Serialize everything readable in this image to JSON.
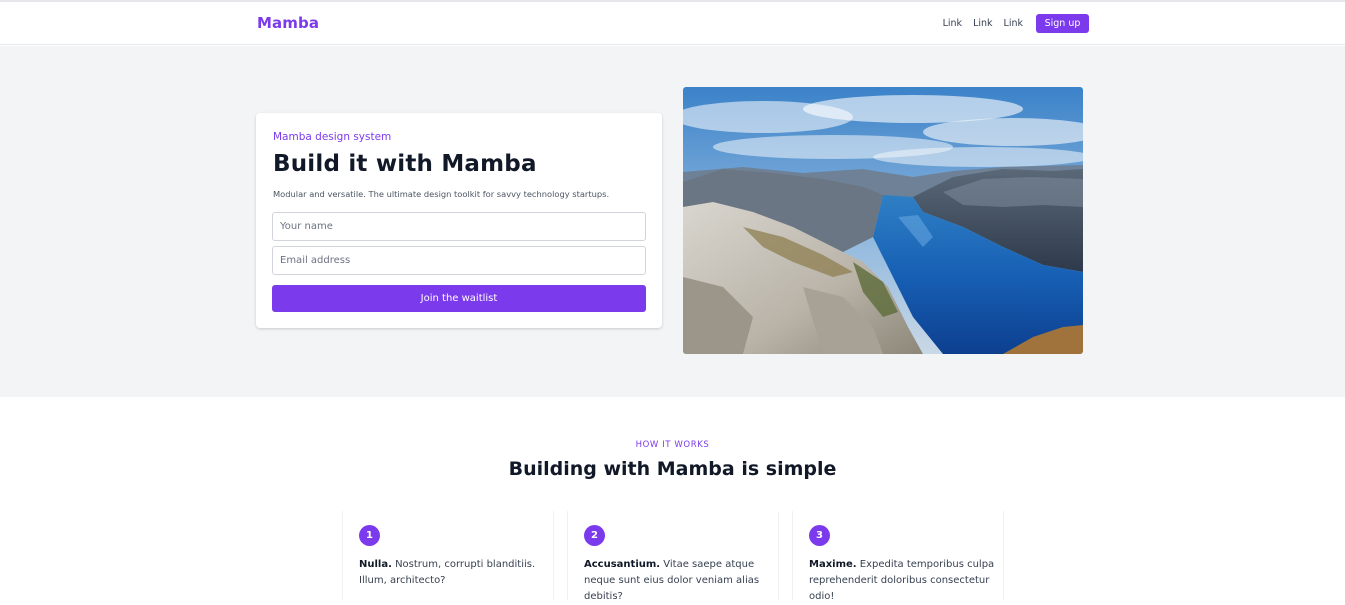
{
  "header": {
    "brand": "Mamba",
    "links": [
      "Link",
      "Link",
      "Link"
    ],
    "signup_label": "Sign up"
  },
  "hero": {
    "eyebrow": "Mamba design system",
    "title": "Build it with Mamba",
    "description": "Modular and versatile. The ultimate design toolkit for savvy technology startups.",
    "name_placeholder": "Your name",
    "email_placeholder": "Email address",
    "cta_label": "Join the waitlist",
    "image": "fjord-landscape-photo"
  },
  "how": {
    "eyebrow": "HOW IT WORKS",
    "title": "Building with Mamba is simple",
    "steps": [
      {
        "number": "1",
        "bold": "Nulla.",
        "text": " Nostrum, corrupti blanditiis. Illum, architecto?"
      },
      {
        "number": "2",
        "bold": "Accusantium.",
        "text": " Vitae saepe atque neque sunt eius dolor veniam alias debitis?"
      },
      {
        "number": "3",
        "bold": "Maxime.",
        "text": " Expedita temporibus culpa reprehenderit doloribus consectetur odio!"
      }
    ]
  },
  "colors": {
    "accent": "#7c3aed",
    "hero_background": "#f3f4f6",
    "heading": "#111827"
  }
}
